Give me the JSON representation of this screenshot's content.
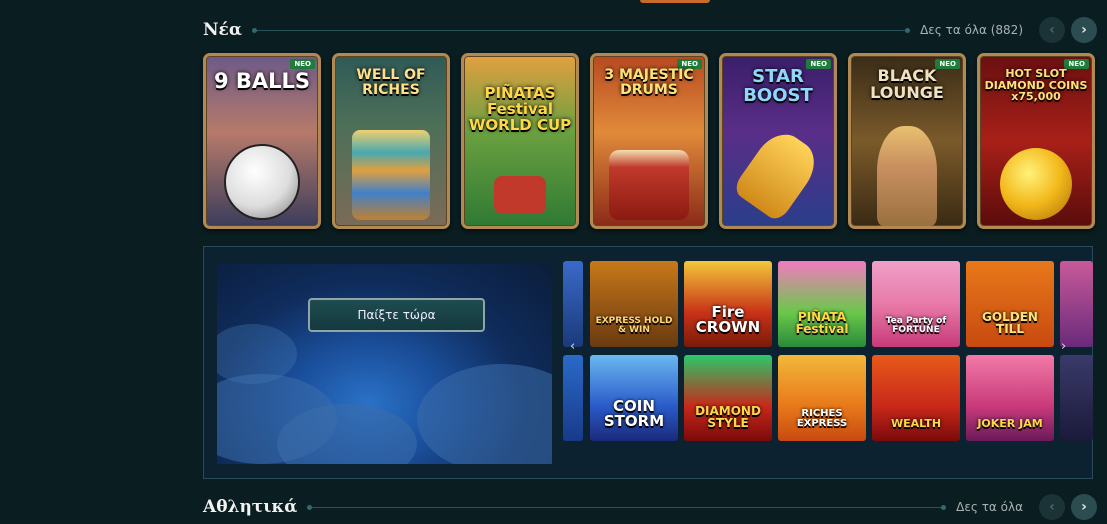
{
  "sections": {
    "new": {
      "title": "Νέα",
      "see_all": "Δες τα όλα (882)"
    },
    "sports": {
      "title": "Αθλητικά",
      "see_all": "Δες τα όλα"
    }
  },
  "icons": {
    "prev": "chevron-left-icon",
    "next": "chevron-right-icon"
  },
  "new_games": [
    {
      "title": "9 BALLS",
      "badge": "ΝΕΟ"
    },
    {
      "title": "WELL OF RICHES",
      "badge": ""
    },
    {
      "title": "PIÑATAS Festival WORLD CUP",
      "badge": ""
    },
    {
      "title": "3 MAJESTIC DRUMS",
      "badge": "ΝΕΟ"
    },
    {
      "title": "STAR BOOST",
      "badge": "ΝΕΟ"
    },
    {
      "title": "BLACK LOUNGE",
      "badge": "ΝΕΟ"
    },
    {
      "title": "HOT SLOT DIAMOND COINS x75,000",
      "badge": "ΝΕΟ"
    }
  ],
  "promo": {
    "play_button": "Παίξτε τώρα",
    "games_top": [
      "EXPRESS HOLD & WIN",
      "Fire CROWN",
      "PIÑATA Festival",
      "Tea Party of FORTUNE",
      "GOLDEN TILL"
    ],
    "games_bottom": [
      "COIN STORM",
      "DIAMOND STYLE",
      "RICHES EXPRESS",
      "WEALTH",
      "JOKER JAM"
    ]
  }
}
